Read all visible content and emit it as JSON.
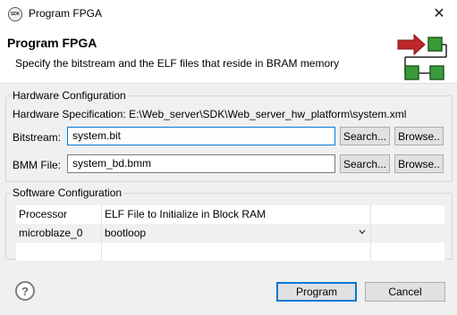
{
  "window": {
    "app_icon_text": "SDK",
    "title": "Program FPGA",
    "close_glyph": "✕"
  },
  "header": {
    "title": "Program FPGA",
    "description": "Specify the bitstream and the ELF files that reside in BRAM memory",
    "graphic_icon": "program-fpga-wizard-icon"
  },
  "hardware": {
    "legend": "Hardware Configuration",
    "spec_label": "Hardware Specification:",
    "spec_path": "E:\\Web_server\\SDK\\Web_server_hw_platform\\system.xml",
    "bitstream_label": "Bitstream:",
    "bitstream_value": "system.bit",
    "bmm_label": "BMM File:",
    "bmm_value": "system_bd.bmm",
    "search_label": "Search...",
    "browse_label": "Browse.."
  },
  "software": {
    "legend": "Software Configuration",
    "columns": [
      "Processor",
      "ELF File to Initialize in Block RAM"
    ],
    "rows": [
      {
        "processor": "microblaze_0",
        "elf": "bootloop"
      }
    ]
  },
  "footer": {
    "help_glyph": "?",
    "program_label": "Program",
    "cancel_label": "Cancel"
  },
  "colors": {
    "accent": "#0078d7",
    "arrow_red": "#c0272d",
    "block_green": "#3a9a3a"
  }
}
